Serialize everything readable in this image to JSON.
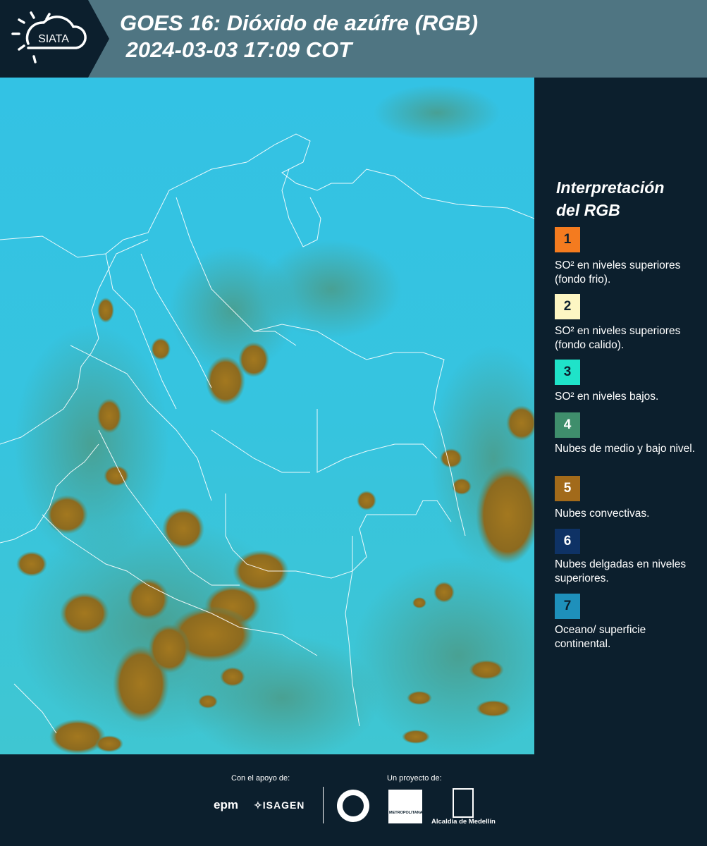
{
  "header": {
    "logo_text": "SIATA",
    "title_line1": "GOES 16: Dióxido de azúfre (RGB)",
    "title_line2": " 2024-03-03 17:09 COT"
  },
  "legend": {
    "title_line1": "Interpretación",
    "title_line2": "del RGB",
    "items": [
      {
        "num": "1",
        "color": "#f47b1f",
        "num_color": "#0c1f2d",
        "text": "SO² en niveles superiores (fondo frio)."
      },
      {
        "num": "2",
        "color": "#fdf6c3",
        "num_color": "#0c1f2d",
        "text": "SO² en niveles superiores (fondo calido)."
      },
      {
        "num": "3",
        "color": "#1fe3c9",
        "num_color": "#0c1f2d",
        "text": "SO² en niveles bajos."
      },
      {
        "num": "4",
        "color": "#3f8e6c",
        "num_color": "#ffffff",
        "text": "Nubes de medio y bajo nivel."
      },
      {
        "num": "5",
        "color": "#a26a1a",
        "num_color": "#ffffff",
        "text": "Nubes convectivas."
      },
      {
        "num": "6",
        "color": "#0e3265",
        "num_color": "#ffffff",
        "text": "Nubes delgadas en niveles superiores."
      },
      {
        "num": "7",
        "color": "#1e90bb",
        "num_color": "#0c1f2d",
        "text": "Oceano/ superficie continental."
      }
    ]
  },
  "footer": {
    "support_label": "Con el apoyo de:",
    "project_label": "Un proyecto de:",
    "sponsor1": "epm",
    "sponsor2": "ISAGEN",
    "partner1": "METROPOLITANA",
    "partner2": "Alcaldía de Medellín"
  },
  "colors": {
    "header_bg": "#4f7582",
    "panel_bg": "#0c1f2d",
    "map_cyan": "#2bb8d9",
    "cloud_brown": "#a3781f",
    "cloud_green": "#4b9a87"
  }
}
